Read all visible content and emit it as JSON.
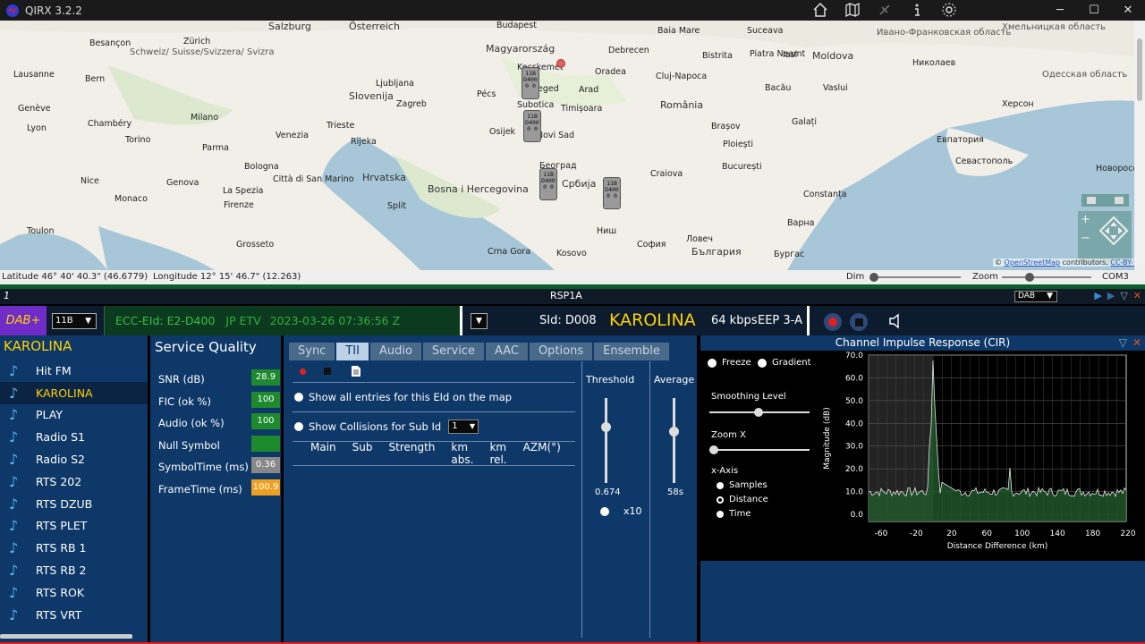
{
  "app": {
    "title": "QIRX 3.2.2"
  },
  "window": {
    "minimize": "─",
    "maximize": "☐",
    "close": "✕"
  },
  "map": {
    "labels": [
      {
        "t": "Salzburg"
      },
      {
        "t": "Österreich"
      },
      {
        "t": "Budapest"
      },
      {
        "t": "Baia Mare"
      },
      {
        "t": "Suceava"
      },
      {
        "t": "Ивано-Франковская область"
      },
      {
        "t": "Хмельницкая область"
      },
      {
        "t": "Одесская область"
      },
      {
        "t": "Besançon"
      },
      {
        "t": "Zürich"
      },
      {
        "t": "Schweiz/ Suisse/Svizzera/ Svizra"
      },
      {
        "t": "Magyarország"
      },
      {
        "t": "Debrecen"
      },
      {
        "t": "Oradea"
      },
      {
        "t": "Bistrita"
      },
      {
        "t": "Piatra Neamt"
      },
      {
        "t": "Iasi"
      },
      {
        "t": "Moldova"
      },
      {
        "t": "Николаев"
      },
      {
        "t": "Херсон"
      },
      {
        "t": "Lausanne"
      },
      {
        "t": "Bern"
      },
      {
        "t": "Ljubljana"
      },
      {
        "t": "Slovenija"
      },
      {
        "t": "Kecskemét"
      },
      {
        "t": "Arad"
      },
      {
        "t": "Cluj-Napoca"
      },
      {
        "t": "Bacău"
      },
      {
        "t": "Vaslui"
      },
      {
        "t": "Genève"
      },
      {
        "t": "Milano"
      },
      {
        "t": "Venezia"
      },
      {
        "t": "Trieste"
      },
      {
        "t": "Zagreb"
      },
      {
        "t": "Pécs"
      },
      {
        "t": "Szeged"
      },
      {
        "t": "Timișoara"
      },
      {
        "t": "România"
      },
      {
        "t": "Galați"
      },
      {
        "t": "Brașov"
      },
      {
        "t": "Lyon"
      },
      {
        "t": "Chambéry"
      },
      {
        "t": "Torino"
      },
      {
        "t": "Parma"
      },
      {
        "t": "Bologna"
      },
      {
        "t": "Rijeka"
      },
      {
        "t": "Hrvatska"
      },
      {
        "t": "Subotica"
      },
      {
        "t": "Osijek"
      },
      {
        "t": "Novi Sad"
      },
      {
        "t": "Ploiești"
      },
      {
        "t": "Евпатория"
      },
      {
        "t": "Севастополь"
      },
      {
        "t": "Nice"
      },
      {
        "t": "Monaco"
      },
      {
        "t": "Genova"
      },
      {
        "t": "La Spezia"
      },
      {
        "t": "Firenze"
      },
      {
        "t": "Città di San Marino"
      },
      {
        "t": "Split"
      },
      {
        "t": "Bosna i Hercegovina"
      },
      {
        "t": "Београд"
      },
      {
        "t": "Србија"
      },
      {
        "t": "Craiova"
      },
      {
        "t": "București"
      },
      {
        "t": "Constanța"
      },
      {
        "t": "Toulon"
      },
      {
        "t": "Grosseto"
      },
      {
        "t": "Crna Gora"
      },
      {
        "t": "Kosovo"
      },
      {
        "t": "Ниш"
      },
      {
        "t": "София"
      },
      {
        "t": "Варна"
      },
      {
        "t": "Ловеч"
      },
      {
        "t": "България"
      },
      {
        "t": "Бургас"
      },
      {
        "t": "Новоросс..."
      }
    ],
    "pins": [
      {
        "lines": [
          "11B",
          "D400",
          "0 0"
        ]
      },
      {
        "lines": [
          "11B",
          "D400",
          "0 0"
        ]
      },
      {
        "lines": [
          "11B",
          "D400",
          "0 0"
        ]
      },
      {
        "lines": [
          "11B",
          "D400",
          "0 0"
        ]
      }
    ],
    "attribution": "© OpenStreetMap contributors, CC-BY-SA",
    "attr_copy": "©",
    "attr_link1": "OpenStreetMap",
    "attr_mid": "contributors,",
    "attr_link2": "CC-BY-SA"
  },
  "status": {
    "latitude": "Latitude  46° 40' 40.3\" (46.6779)",
    "longitude": "Longitude  12° 15' 46.7\" (12.263)",
    "dim": "Dim",
    "zoom": "Zoom",
    "com": "COM3"
  },
  "device": {
    "number": "1",
    "name": "RSP1A",
    "mode": "DAB"
  },
  "header": {
    "dab_plus": "DAB+",
    "channel": "11B",
    "ecc": "ECC-EId: E2-D400",
    "label": "JP ETV",
    "datetime": "2023-03-26  07:36:56 Z",
    "sid": "SId: D008",
    "service": "KAROLINA",
    "bitrate": "64 kbps",
    "eep": "EEP 3-A"
  },
  "services": {
    "title": "KAROLINA",
    "items": [
      "Hit FM",
      "KAROLINA",
      "PLAY",
      "Radio S1",
      "Radio S2",
      "RTS 202",
      "RTS DZUB",
      "RTS PLET",
      "RTS RB 1",
      "RTS RB 2",
      "RTS ROK",
      "RTS VRT"
    ],
    "selected_index": 1
  },
  "quality": {
    "title": "Service Quality",
    "rows": [
      {
        "label": "SNR (dB)",
        "value": "28.9",
        "color": "#1d8a2e"
      },
      {
        "label": "FIC (ok %)",
        "value": "100",
        "color": "#1d8a2e"
      },
      {
        "label": "Audio (ok %)",
        "value": "100",
        "color": "#1d8a2e"
      },
      {
        "label": "Null Symbol",
        "value": "",
        "color": "#1d8a2e"
      },
      {
        "label": "SymbolTime (ms)",
        "value": "0.36",
        "color": "#888888"
      },
      {
        "label": "FrameTime (ms)",
        "value": "100.9",
        "color": "#f0a020"
      }
    ]
  },
  "tabs": {
    "items": [
      "Sync",
      "TII",
      "Audio",
      "Service",
      "AAC",
      "Options",
      "Ensemble"
    ],
    "active": "TII",
    "show_all": "Show all entries for this EId on the map",
    "show_collisions": "Show Collisions for Sub Id",
    "sub_id": "1",
    "columns": [
      "Main",
      "Sub",
      "Strength",
      "km abs.",
      "km rel.",
      "AZM(°)"
    ],
    "threshold_label": "Threshold",
    "threshold_value": "0.674",
    "average_label": "Average",
    "average_value": "58s",
    "x10": "x10"
  },
  "cir": {
    "title": "Channel Impulse Response (CIR)",
    "freeze": "Freeze",
    "gradient": "Gradient",
    "smoothing": "Smoothing Level",
    "zoomx": "Zoom X",
    "xaxis": "x-Axis",
    "opt_samples": "Samples",
    "opt_distance": "Distance",
    "opt_time": "Time",
    "ylabel": "Magnitude (dB)",
    "xlabel": "Distance Difference (km)",
    "yticks": [
      "70.0",
      "60.0",
      "50.0",
      "40.0",
      "30.0",
      "20.0",
      "10.0",
      "0.0"
    ],
    "xticks": [
      "-60",
      "-20",
      "20",
      "60",
      "100",
      "140",
      "180",
      "220"
    ]
  }
}
